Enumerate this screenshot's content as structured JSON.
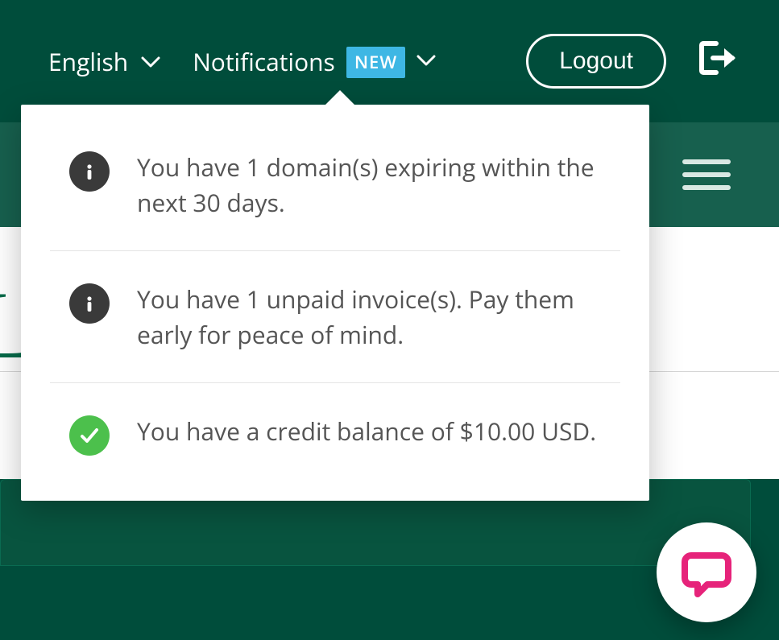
{
  "topbar": {
    "language": "English",
    "notifications_label": "Notifications",
    "notifications_badge": "NEW",
    "logout_label": "Logout"
  },
  "notifications": [
    {
      "icon": "info",
      "text": "You have 1 domain(s) expiring within the next 30 days."
    },
    {
      "icon": "info",
      "text": "You have 1 unpaid invoice(s). Pay them early for peace of mind."
    },
    {
      "icon": "success",
      "text": "You have a credit balance of $10.00 USD."
    }
  ],
  "colors": {
    "brand_dark": "#004d3b",
    "brand_mid": "#17604e",
    "accent_blue": "#3eb7e4",
    "success_green": "#4cc04c",
    "chat_pink": "#e6237a"
  }
}
